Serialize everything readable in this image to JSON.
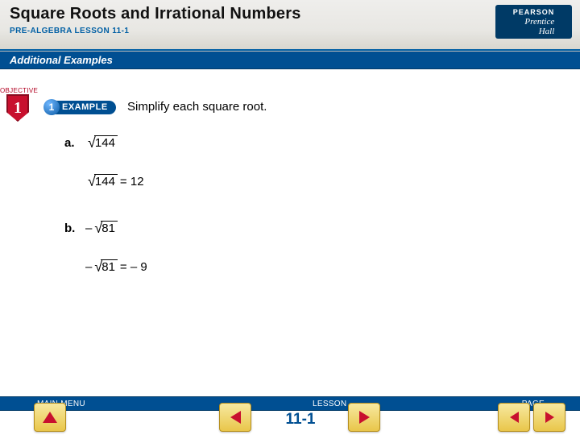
{
  "header": {
    "title": "Square Roots and Irrational Numbers",
    "subtitle": "PRE-ALGEBRA LESSON 11-1",
    "publisher_top": "PEARSON",
    "publisher_line1": "Prentice",
    "publisher_line2": "Hall"
  },
  "bar": {
    "examples_label": "Additional Examples"
  },
  "objective": {
    "label": "OBJECTIVE",
    "number": "1"
  },
  "example_pill": {
    "number": "1",
    "label": "EXAMPLE"
  },
  "instruction": "Simplify each square root.",
  "problems": {
    "a": {
      "label": "a.",
      "radicand": "144",
      "solution_radicand": "144",
      "equals": " = 12"
    },
    "b": {
      "label": "b.",
      "prefix": "–",
      "radicand": "81",
      "solution_prefix": "–",
      "solution_radicand": "81",
      "equals": " = – 9"
    }
  },
  "footer": {
    "main_menu": "MAIN MENU",
    "lesson": "LESSON",
    "page": "PAGE",
    "lesson_number": "11-1"
  }
}
